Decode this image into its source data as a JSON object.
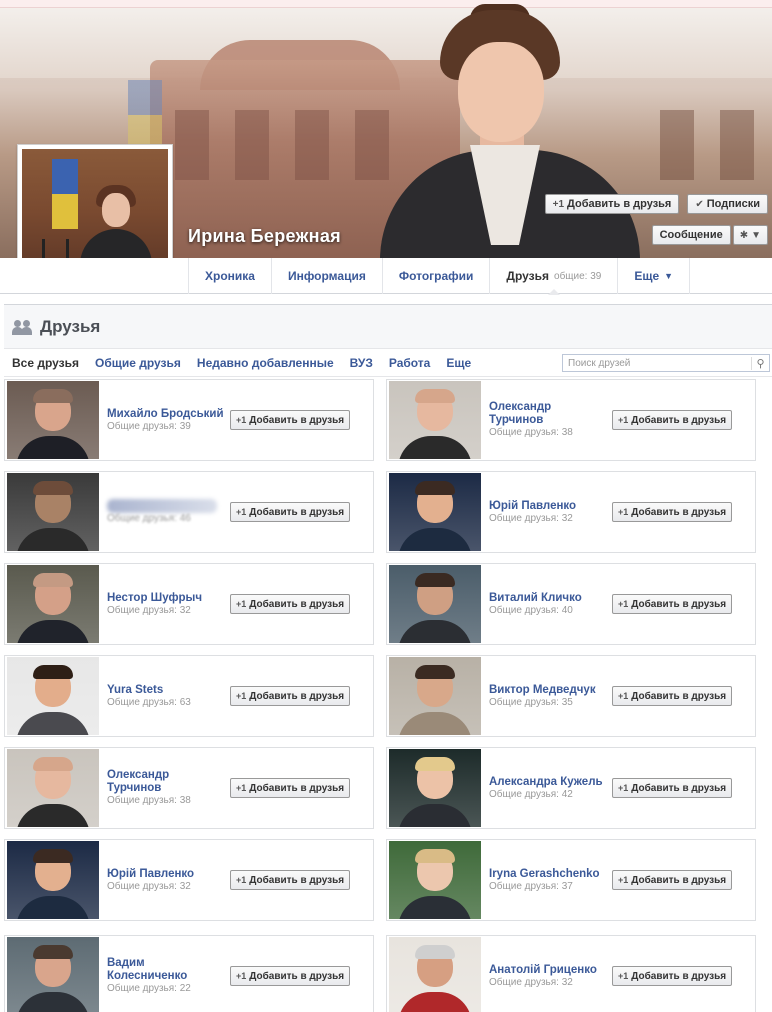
{
  "profile": {
    "name": "Ирина Бережная",
    "actions": {
      "add_friend": "Добавить в друзья",
      "add_friend_icon": "+1",
      "subscriptions": "Подписки",
      "subscriptions_icon": "✔",
      "message": "Сообщение",
      "gear_icon": "✱",
      "caret_icon": "▼"
    }
  },
  "tabs": [
    {
      "label": "Хроника"
    },
    {
      "label": "Информация"
    },
    {
      "label": "Фотографии"
    },
    {
      "label": "Друзья",
      "sub": "общие: 39"
    },
    {
      "label": "Еще",
      "caret": "▼"
    }
  ],
  "friends": {
    "title": "Друзья",
    "filters": [
      "Все друзья",
      "Общие друзья",
      "Недавно добавленные",
      "ВУЗ",
      "Работа",
      "Еще"
    ],
    "search_placeholder": "Поиск друзей",
    "search_icon": "⚲",
    "add_label": "Добавить в друзья",
    "add_icon": "+1",
    "list": [
      {
        "name": "Михайло Бродський",
        "mutual": "Общие друзья: 39"
      },
      {
        "name": "Олександр Турчинов",
        "mutual": "Общие друзья: 38"
      },
      {
        "name": "",
        "mutual": "Общие друзья: 46"
      },
      {
        "name": "Юрій Павленко",
        "mutual": "Общие друзья: 32"
      },
      {
        "name": "Нестор Шуфрыч",
        "mutual": "Общие друзья: 32"
      },
      {
        "name": "Виталий Кличко",
        "mutual": "Общие друзья: 40"
      },
      {
        "name": "Yura Stets",
        "mutual": "Общие друзья: 63"
      },
      {
        "name": "Виктор Медведчук",
        "mutual": "Общие друзья: 35"
      },
      {
        "name": "Олександр Турчинов",
        "mutual": "Общие друзья: 38"
      },
      {
        "name": "Александра Кужель",
        "mutual": "Общие друзья: 42"
      },
      {
        "name": "Юрій Павленко",
        "mutual": "Общие друзья: 32"
      },
      {
        "name": "Iryna Gerashchenko",
        "mutual": "Общие друзья: 37"
      },
      {
        "name": "Вадим Колесниченко",
        "mutual": "Общие друзья: 22"
      },
      {
        "name": "Анатолій Гриценко",
        "mutual": "Общие друзья: 32"
      }
    ]
  },
  "colors": {
    "link": "#3b5998",
    "muted": "#999999",
    "border": "#dddfe2"
  }
}
